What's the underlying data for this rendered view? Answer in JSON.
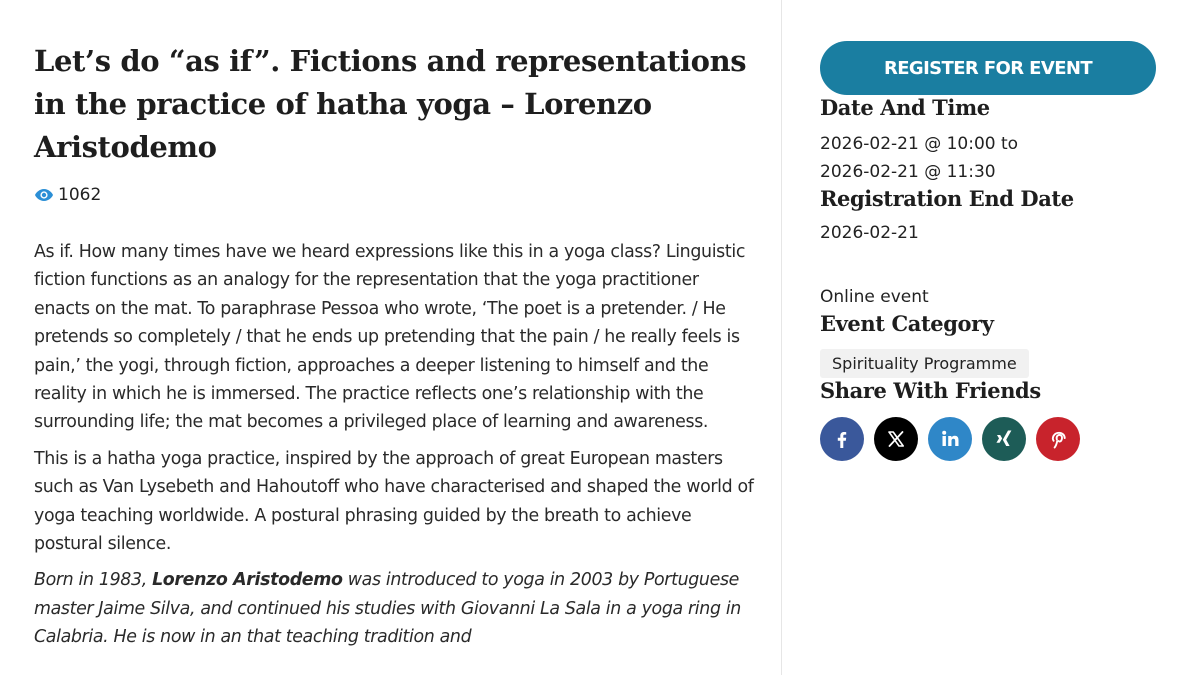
{
  "event": {
    "title": "Let’s do “as if”. Fictions and representations in the practice of hatha yoga – Lorenzo Aristodemo",
    "views": "1062",
    "paragraphs": [
      "As if. How many times have we heard expressions like this in a yoga class? Linguistic fiction functions as an analogy for the representation that the yoga practitioner enacts on the mat. To paraphrase Pessoa who wrote, ‘The poet is a pretender. / He pretends so completely / that he ends up pretending that the pain / he really feels is pain,’ the yogi, through fiction, approaches a deeper listening to himself and the reality in which he is immersed. The practice reflects one’s relationship with the surrounding life; the mat becomes a privileged place of learning and awareness.",
      "This is a hatha yoga practice, inspired by the approach of great European masters such as Van Lysebeth and Hahoutoff who have characterised and shaped the world of yoga teaching worldwide. A postural phrasing guided by the breath to achieve postural silence."
    ],
    "bio": {
      "prefix": "Born in 1983, ",
      "name": "Lorenzo Aristodemo",
      "text": " was introduced to yoga in 2003 by Portuguese master Jaime Silva, and continued his studies with Giovanni La Sala in a yoga ring in Calabria. He is now in an that teaching tradition and"
    }
  },
  "sidebar": {
    "register_label": "REGISTER FOR EVENT",
    "date_heading": "Date And Time",
    "date_start": "2026-02-21 @ 10:00 to",
    "date_end": "2026-02-21 @ 11:30",
    "reg_end_heading": "Registration End Date",
    "reg_end_date": "2026-02-21",
    "online_label": "Online event",
    "category_heading": "Event Category",
    "category": "Spirituality Programme",
    "share_heading": "Share With Friends",
    "share_icons": [
      "facebook-icon",
      "x-icon",
      "linkedin-icon",
      "xing-icon",
      "pinterest-icon"
    ]
  },
  "colors": {
    "accent": "#1a7ea1",
    "facebook": "#3a589b",
    "x": "#000000",
    "linkedin": "#2f87c8",
    "xing": "#1d5c57",
    "pinterest": "#c8232c"
  }
}
